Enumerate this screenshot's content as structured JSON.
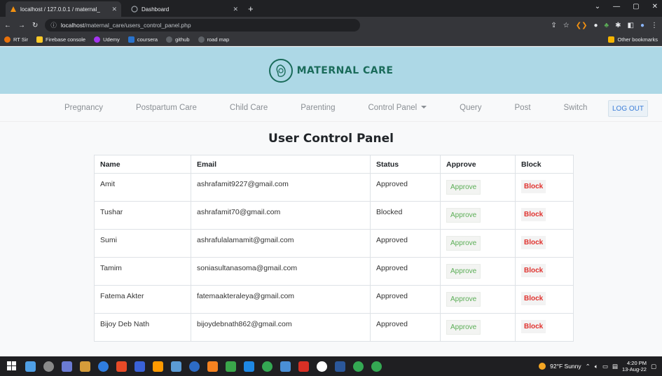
{
  "browser": {
    "tabs": [
      {
        "title": "localhost / 127.0.0.1 / maternal_",
        "active": true
      },
      {
        "title": "Dashboard",
        "active": false
      }
    ],
    "new_tab_label": "+",
    "url_host": "localhost",
    "url_path": "/maternal_care/users_control_panel.php",
    "bookmarks": [
      "RT Sir",
      "Firebase console",
      "Udemy",
      "coursera",
      "github",
      "road map"
    ],
    "other_bookmarks": "Other bookmarks"
  },
  "site": {
    "brand": "MATERNAL CARE",
    "nav": [
      {
        "label": "Pregnancy"
      },
      {
        "label": "Postpartum Care"
      },
      {
        "label": "Child Care"
      },
      {
        "label": "Parenting"
      },
      {
        "label": "Control Panel"
      },
      {
        "label": "Query"
      },
      {
        "label": "Post"
      },
      {
        "label": "Switch"
      }
    ],
    "logout_label": "LOG OUT"
  },
  "panel": {
    "title": "User Control Panel",
    "columns": [
      "Name",
      "Email",
      "Status",
      "Approve",
      "Block"
    ],
    "approve_label": "Approve",
    "block_label": "Block",
    "rows": [
      {
        "name": "Amit",
        "email": "ashrafamit9227@gmail.com",
        "status": "Approved"
      },
      {
        "name": "Tushar",
        "email": "ashrafamit70@gmail.com",
        "status": "Blocked"
      },
      {
        "name": "Sumi",
        "email": "ashrafulalamamit@gmail.com",
        "status": "Approved"
      },
      {
        "name": "Tamim",
        "email": "soniasultanasoma@gmail.com",
        "status": "Approved"
      },
      {
        "name": "Fatema Akter",
        "email": "fatemaakteraleya@gmail.com",
        "status": "Approved"
      },
      {
        "name": "Bijoy Deb Nath",
        "email": "bijoydebnath862@gmail.com",
        "status": "Approved"
      }
    ]
  },
  "taskbar": {
    "weather": "92°F Sunny",
    "time": "4:20 PM",
    "date": "13-Aug-22"
  },
  "colors": {
    "banner": "#add8e6",
    "brand_green": "#1a6b5a",
    "approve_green": "#5cae57",
    "block_red": "#e0322e",
    "logout_blue": "#3b7dd8"
  }
}
